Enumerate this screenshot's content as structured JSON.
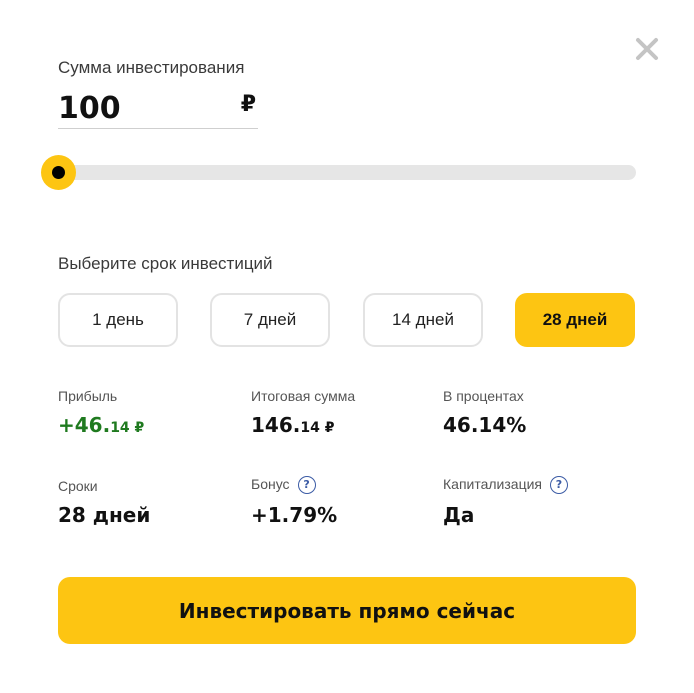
{
  "amount": {
    "label": "Сумма инвестирования",
    "value": "100",
    "currency": "₽",
    "slider_fraction": 0
  },
  "term": {
    "label": "Выберите срок инвестиций",
    "options": [
      {
        "label": "1 день",
        "active": false
      },
      {
        "label": "7 дней",
        "active": false
      },
      {
        "label": "14 дней",
        "active": false
      },
      {
        "label": "28 дней",
        "active": true
      }
    ]
  },
  "stats": {
    "profit": {
      "label": "Прибыль",
      "whole": "+46.",
      "fraction": "14 ₽"
    },
    "total": {
      "label": "Итоговая сумма",
      "whole": "146.",
      "fraction": "14 ₽"
    },
    "percent": {
      "label": "В процентах",
      "value": "46.14%"
    },
    "period": {
      "label": "Сроки",
      "value": "28 дней"
    },
    "bonus": {
      "label": "Бонус",
      "value": "+1.79%",
      "help": "?"
    },
    "capitalization": {
      "label": "Капитализация",
      "value": "Да",
      "help": "?"
    }
  },
  "cta": {
    "label": "Инвестировать прямо сейчас"
  },
  "colors": {
    "accent": "#fdc512",
    "positive": "#1f7a1f",
    "help": "#3b5ba5"
  }
}
